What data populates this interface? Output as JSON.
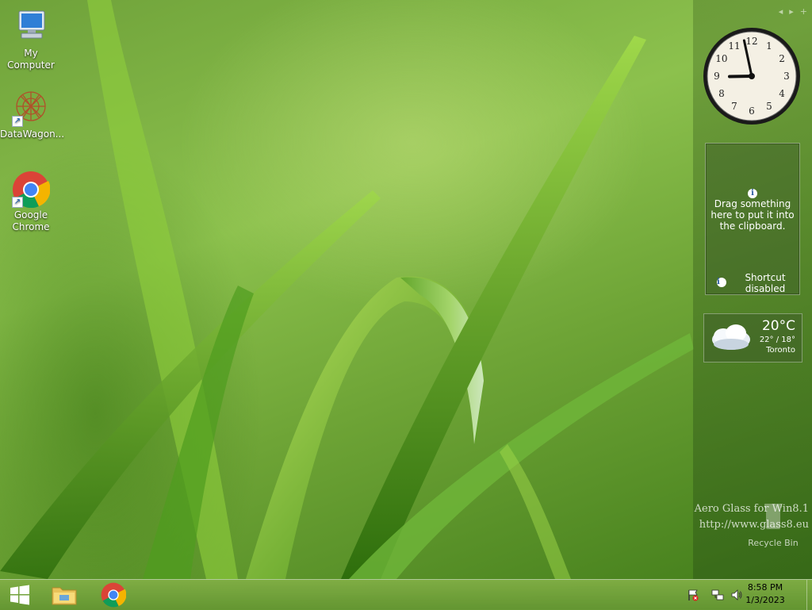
{
  "desktop": {
    "icons": [
      {
        "label": "My Computer"
      },
      {
        "label": "DataWagon..."
      },
      {
        "label": "Google Chrome"
      }
    ]
  },
  "clock": {
    "hour": 8,
    "minute": 58
  },
  "clipboard_gadget": {
    "message": "Drag something here to put it into the clipboard.",
    "shortcut_status": "Shortcut disabled"
  },
  "weather": {
    "temperature": "20°C",
    "range": "22° / 18°",
    "city": "Toronto"
  },
  "watermark": {
    "line1": "Aero Glass for Win8.1",
    "line2": "http://www.glass8.eu"
  },
  "recycle_bin": {
    "label": "Recycle Bin"
  },
  "taskbar": {
    "time": "8:58 PM",
    "date": "1/3/2023"
  },
  "colors": {
    "taskbar": "#8ab84c",
    "chrome_red": "#db4437",
    "chrome_yellow": "#f4b400",
    "chrome_green": "#0f9d58",
    "chrome_blue": "#4285f4"
  }
}
